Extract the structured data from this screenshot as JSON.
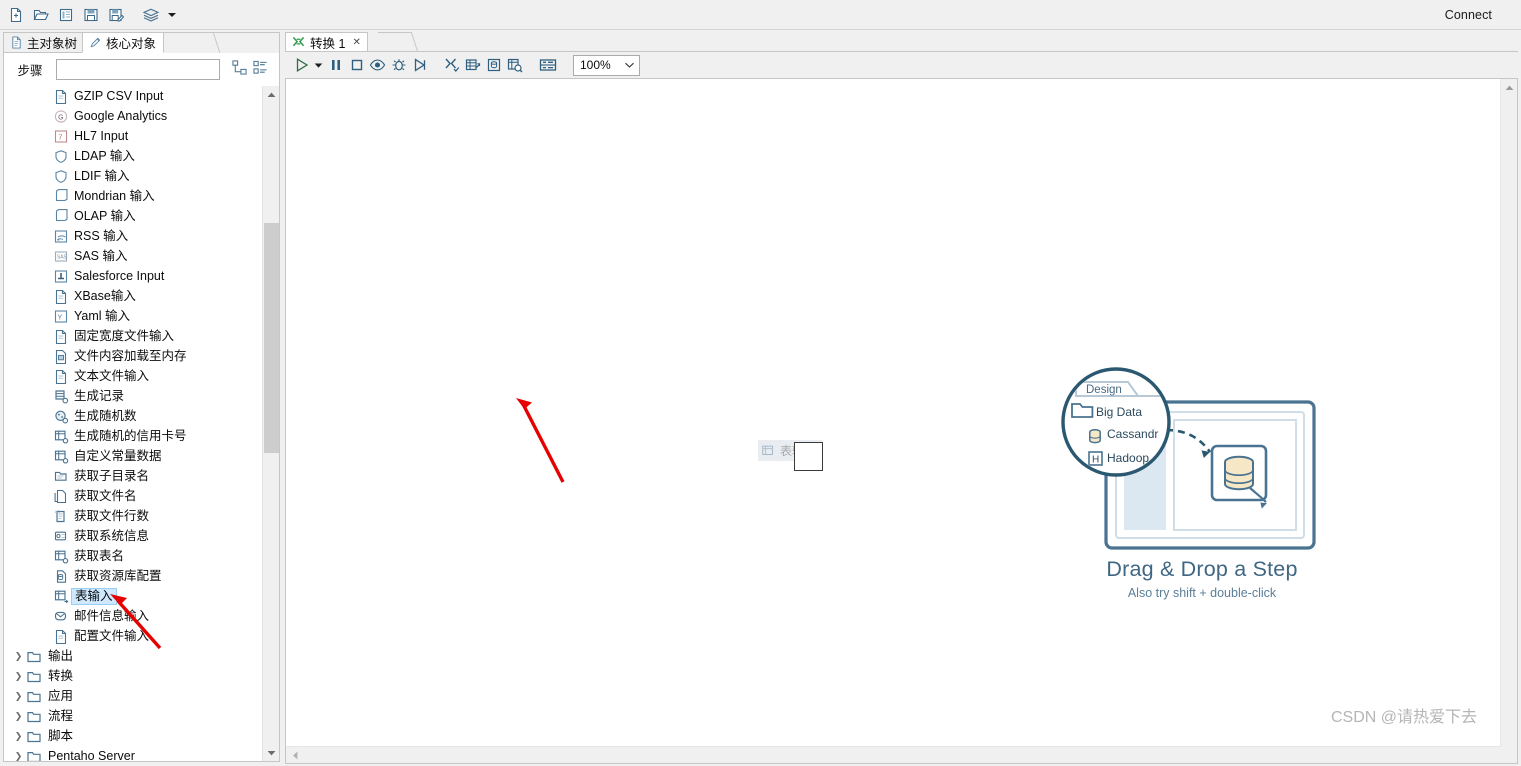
{
  "window": {
    "connect_label": "Connect",
    "watermark": "CSDN @请热爱下去"
  },
  "toolbar": {
    "items": [
      {
        "name": "new-file-icon",
        "tooltip": "新建"
      },
      {
        "name": "open-file-icon",
        "tooltip": "打开"
      },
      {
        "name": "explorer-icon",
        "tooltip": "浏览"
      },
      {
        "name": "save-icon",
        "tooltip": "保存"
      },
      {
        "name": "save-as-icon",
        "tooltip": "另存为"
      },
      {
        "name": "layers-icon",
        "tooltip": "视图"
      },
      {
        "name": "dropdown-caret-icon",
        "tooltip": "更多"
      }
    ]
  },
  "left_panel": {
    "tabs": [
      {
        "label": "主对象树",
        "icon": "document-icon",
        "active": false
      },
      {
        "label": "核心对象",
        "icon": "pencil-icon",
        "active": true
      }
    ],
    "search": {
      "label": "步骤",
      "value": "",
      "placeholder": ""
    },
    "search_icons": [
      {
        "name": "expand-all-icon"
      },
      {
        "name": "collapse-all-icon"
      }
    ],
    "tree_items": [
      {
        "label": "GZIP CSV Input",
        "icon": "file-input-icon",
        "type": "leaf",
        "selected": false
      },
      {
        "label": "Google Analytics",
        "icon": "google-icon",
        "type": "leaf",
        "selected": false
      },
      {
        "label": "HL7 Input",
        "icon": "hl7-icon",
        "type": "leaf",
        "selected": false
      },
      {
        "label": "LDAP 输入",
        "icon": "shield-icon",
        "type": "leaf",
        "selected": false
      },
      {
        "label": "LDIF 输入",
        "icon": "shield-icon",
        "type": "leaf",
        "selected": false
      },
      {
        "label": "Mondrian 输入",
        "icon": "cube-icon",
        "type": "leaf",
        "selected": false
      },
      {
        "label": "OLAP 输入",
        "icon": "cube-icon",
        "type": "leaf",
        "selected": false
      },
      {
        "label": "RSS 输入",
        "icon": "rss-icon",
        "type": "leaf",
        "selected": false
      },
      {
        "label": "SAS 输入",
        "icon": "sas-icon",
        "type": "leaf",
        "selected": false
      },
      {
        "label": "Salesforce Input",
        "icon": "salesforce-icon",
        "type": "leaf",
        "selected": false
      },
      {
        "label": "XBase输入",
        "icon": "file-input-icon",
        "type": "leaf",
        "selected": false
      },
      {
        "label": "Yaml 输入",
        "icon": "yaml-icon",
        "type": "leaf",
        "selected": false
      },
      {
        "label": "固定宽度文件输入",
        "icon": "file-input-icon",
        "type": "leaf",
        "selected": false
      },
      {
        "label": "文件内容加载至内存",
        "icon": "file-memory-icon",
        "type": "leaf",
        "selected": false
      },
      {
        "label": "文本文件输入",
        "icon": "file-input-icon",
        "type": "leaf",
        "selected": false
      },
      {
        "label": "生成记录",
        "icon": "generate-rows-icon",
        "type": "leaf",
        "selected": false
      },
      {
        "label": "生成随机数",
        "icon": "random-icon",
        "type": "leaf",
        "selected": false
      },
      {
        "label": "生成随机的信用卡号",
        "icon": "table-icon",
        "type": "leaf",
        "selected": false
      },
      {
        "label": "自定义常量数据",
        "icon": "table-icon",
        "type": "leaf",
        "selected": false
      },
      {
        "label": "获取子目录名",
        "icon": "folder-list-icon",
        "type": "leaf",
        "selected": false
      },
      {
        "label": "获取文件名",
        "icon": "filename-icon",
        "type": "leaf",
        "selected": false
      },
      {
        "label": "获取文件行数",
        "icon": "linecount-icon",
        "type": "leaf",
        "selected": false
      },
      {
        "label": "获取系统信息",
        "icon": "system-info-icon",
        "type": "leaf",
        "selected": false
      },
      {
        "label": "获取表名",
        "icon": "table-icon",
        "type": "leaf",
        "selected": false
      },
      {
        "label": "获取资源库配置",
        "icon": "repo-icon",
        "type": "leaf",
        "selected": false
      },
      {
        "label": "表输入",
        "icon": "table-input-icon",
        "type": "leaf",
        "selected": true
      },
      {
        "label": "邮件信息输入",
        "icon": "mail-icon",
        "type": "leaf",
        "selected": false
      },
      {
        "label": "配置文件输入",
        "icon": "file-input-icon",
        "type": "leaf",
        "selected": false
      },
      {
        "label": "输出",
        "icon": "folder-icon",
        "type": "folder",
        "selected": false
      },
      {
        "label": "转换",
        "icon": "folder-icon",
        "type": "folder",
        "selected": false
      },
      {
        "label": "应用",
        "icon": "folder-icon",
        "type": "folder",
        "selected": false
      },
      {
        "label": "流程",
        "icon": "folder-icon",
        "type": "folder",
        "selected": false
      },
      {
        "label": "脚本",
        "icon": "folder-icon",
        "type": "folder",
        "selected": false
      },
      {
        "label": "Pentaho Server",
        "icon": "folder-icon",
        "type": "folder",
        "selected": false
      }
    ]
  },
  "editor": {
    "tab": {
      "label": "转换 1",
      "icon": "transformation-icon",
      "close": "✕"
    },
    "toolbar": [
      {
        "name": "run-icon",
        "tooltip": "运行"
      },
      {
        "name": "run-dropdown-icon",
        "tooltip": "运行选项"
      },
      {
        "name": "pause-icon",
        "tooltip": "暂停"
      },
      {
        "name": "stop-icon",
        "tooltip": "停止"
      },
      {
        "name": "preview-icon",
        "tooltip": "预览"
      },
      {
        "name": "debug-icon",
        "tooltip": "调试"
      },
      {
        "name": "replay-icon",
        "tooltip": "重放"
      },
      {
        "name": "verify-icon",
        "tooltip": "检验转换"
      },
      {
        "name": "impact-icon",
        "tooltip": "影响分析"
      },
      {
        "name": "sql-icon",
        "tooltip": "生成SQL"
      },
      {
        "name": "inspect-icon",
        "tooltip": "数据检查"
      },
      {
        "name": "grid-icon",
        "tooltip": "显示网格"
      }
    ],
    "zoom": {
      "value": "100%",
      "caret": "⌄"
    },
    "canvas": {
      "drag_ghost_label": "表输入",
      "placeholder": {
        "magnifier": {
          "tab_label": "Design",
          "items": [
            {
              "label": "Big Data",
              "icon": "folder-icon"
            },
            {
              "label": "Cassandr",
              "icon": "cassandra-icon"
            },
            {
              "label": "Hadoop",
              "icon": "hadoop-icon"
            }
          ]
        },
        "title": "Drag & Drop a Step",
        "subtitle": "Also try shift + double-click"
      }
    }
  },
  "colors": {
    "illustration": "#4a7391",
    "illustration_light": "#b9cedd",
    "accent_db": "#f5e6c8",
    "selection": "#cde8ff",
    "annotation_arrow": "#e60000",
    "toolbar_icon": "#3d6a8a"
  }
}
